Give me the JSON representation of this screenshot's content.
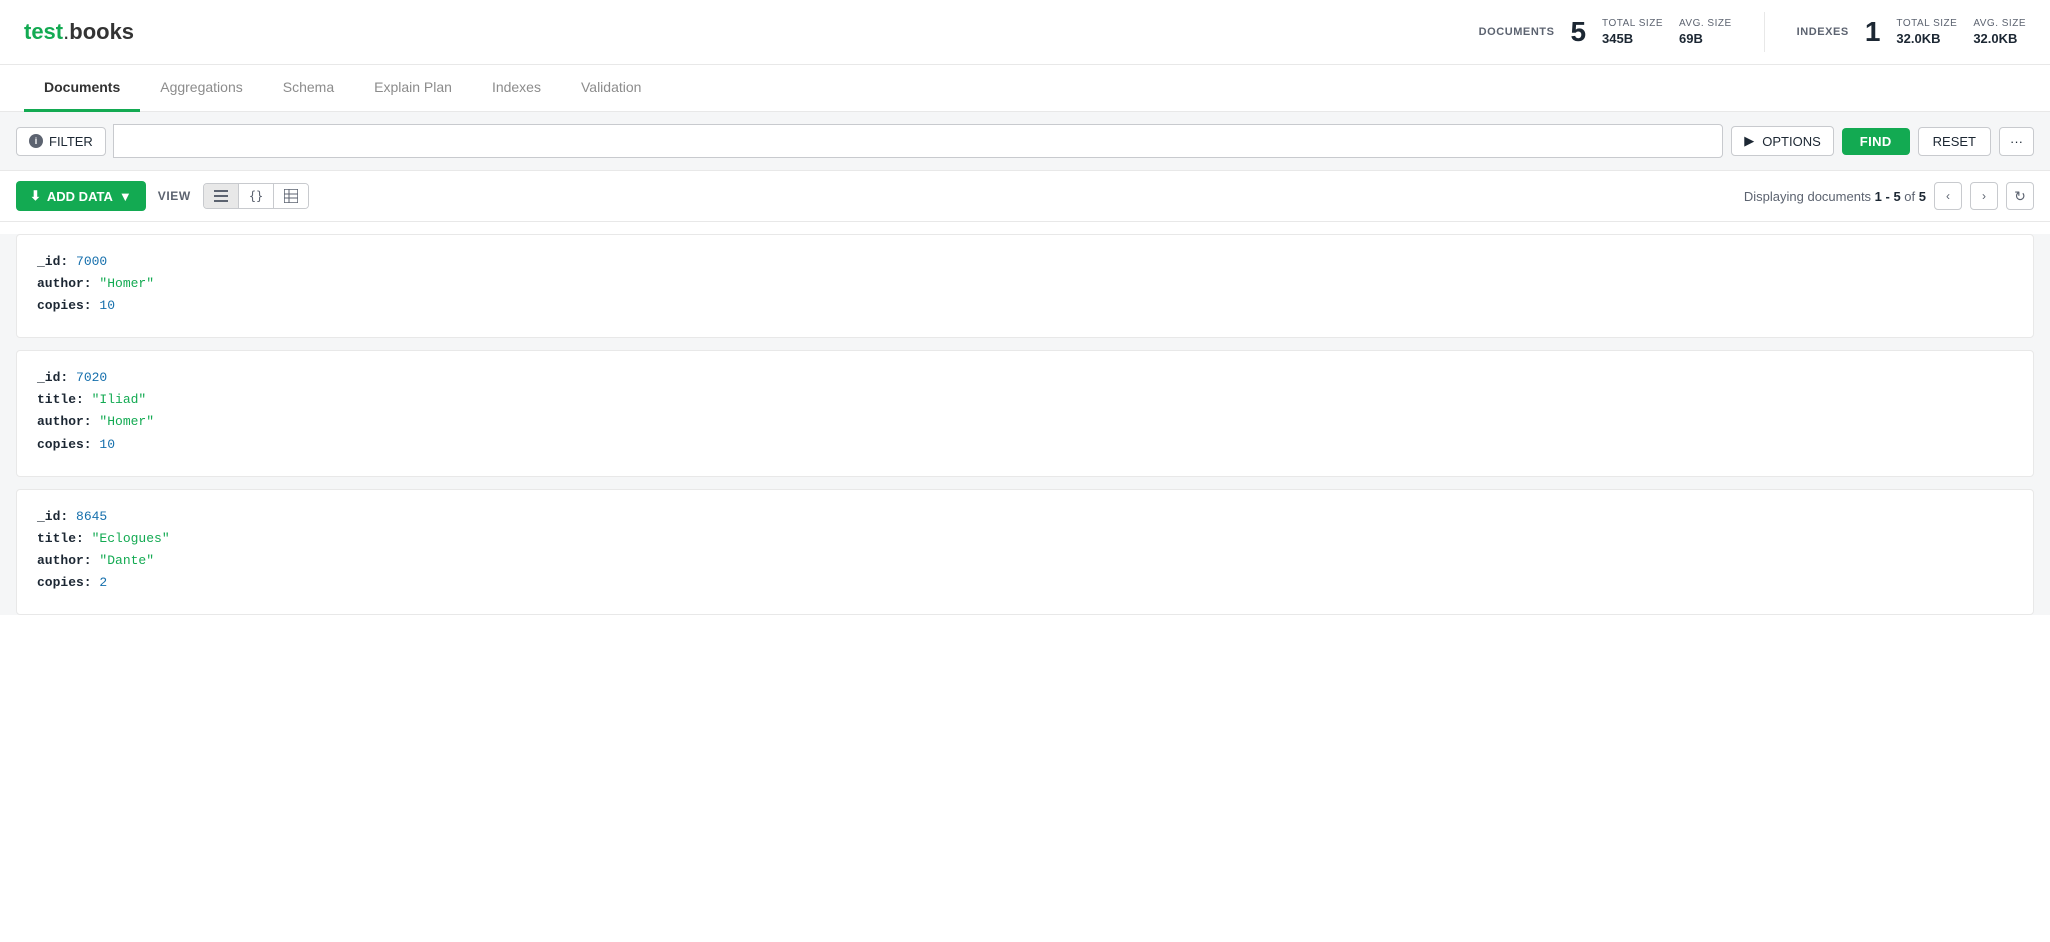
{
  "header": {
    "title_test": "test",
    "title_separator": ".",
    "title_books": "books",
    "documents_label": "DOCUMENTS",
    "documents_count": "5",
    "documents_total_size_label": "TOTAL SIZE",
    "documents_total_size_value": "345B",
    "documents_avg_size_label": "AVG. SIZE",
    "documents_avg_size_value": "69B",
    "indexes_label": "INDEXES",
    "indexes_count": "1",
    "indexes_total_size_label": "TOTAL SIZE",
    "indexes_total_size_value": "32.0KB",
    "indexes_avg_size_label": "AVG. SIZE",
    "indexes_avg_size_value": "32.0KB"
  },
  "tabs": [
    {
      "id": "documents",
      "label": "Documents",
      "active": true
    },
    {
      "id": "aggregations",
      "label": "Aggregations",
      "active": false
    },
    {
      "id": "schema",
      "label": "Schema",
      "active": false
    },
    {
      "id": "explain-plan",
      "label": "Explain Plan",
      "active": false
    },
    {
      "id": "indexes",
      "label": "Indexes",
      "active": false
    },
    {
      "id": "validation",
      "label": "Validation",
      "active": false
    }
  ],
  "toolbar": {
    "filter_label": "FILTER",
    "options_label": "OPTIONS",
    "find_label": "FIND",
    "reset_label": "RESET",
    "more_label": "···"
  },
  "doc_toolbar": {
    "add_data_label": "ADD DATA",
    "view_label": "VIEW",
    "display_text": "Displaying documents",
    "range_start": "1",
    "range_end": "5",
    "total": "5"
  },
  "documents": [
    {
      "id": "doc1",
      "fields": [
        {
          "key": "_id",
          "value": "7000",
          "type": "num"
        },
        {
          "key": "author",
          "value": "\"Homer\"",
          "type": "str"
        },
        {
          "key": "copies",
          "value": "10",
          "type": "num"
        }
      ]
    },
    {
      "id": "doc2",
      "fields": [
        {
          "key": "_id",
          "value": "7020",
          "type": "num"
        },
        {
          "key": "title",
          "value": "\"Iliad\"",
          "type": "str"
        },
        {
          "key": "author",
          "value": "\"Homer\"",
          "type": "str"
        },
        {
          "key": "copies",
          "value": "10",
          "type": "num"
        }
      ]
    },
    {
      "id": "doc3",
      "fields": [
        {
          "key": "_id",
          "value": "8645",
          "type": "num"
        },
        {
          "key": "title",
          "value": "\"Eclogues\"",
          "type": "str"
        },
        {
          "key": "author",
          "value": "\"Dante\"",
          "type": "str"
        },
        {
          "key": "copies",
          "value": "2",
          "type": "num"
        }
      ]
    }
  ]
}
